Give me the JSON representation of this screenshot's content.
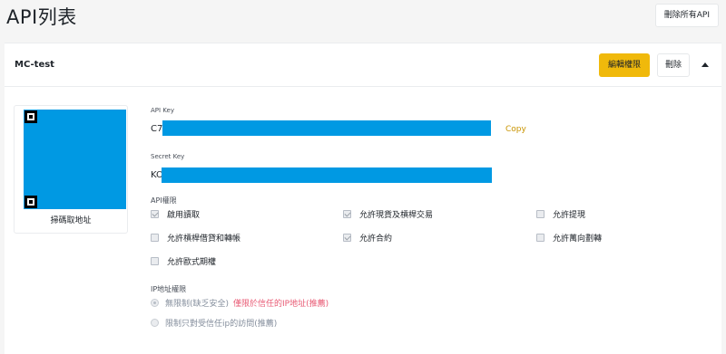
{
  "page": {
    "title": "API列表",
    "delete_all_label": "刪除所有API"
  },
  "api_card": {
    "name": "MC-test",
    "edit_label": "編輯權限",
    "delete_label": "刪除",
    "qr_caption": "掃碼取地址",
    "api_key": {
      "label": "API Key",
      "value_prefix": "C7",
      "copy_label": "Copy"
    },
    "secret_key": {
      "label": "Secret Key",
      "value_prefix": "KO"
    },
    "permissions": {
      "label": "API權限",
      "items": [
        {
          "label": "啟用讀取",
          "checked": true
        },
        {
          "label": "允許現貨及槓桿交易",
          "checked": true
        },
        {
          "label": "允許提現",
          "checked": false
        },
        {
          "label": "允許槓桿借貸和轉帳",
          "checked": false
        },
        {
          "label": "允許合約",
          "checked": true
        },
        {
          "label": "允許萬向劃轉",
          "checked": false
        },
        {
          "label": "允許歐式期權",
          "checked": false
        }
      ]
    },
    "ip_access": {
      "label": "IP地址權限",
      "options": [
        {
          "label": "無限制(缺乏安全)",
          "note": "僅限於信任的IP地址(推薦)",
          "selected": true
        },
        {
          "label": "限制只對受信任ip的訪問(推薦)",
          "selected": false
        }
      ]
    }
  },
  "colors": {
    "accent": "#f0b90b",
    "mask": "#0099e3",
    "warning": "#e85a74",
    "link": "#c99400"
  }
}
